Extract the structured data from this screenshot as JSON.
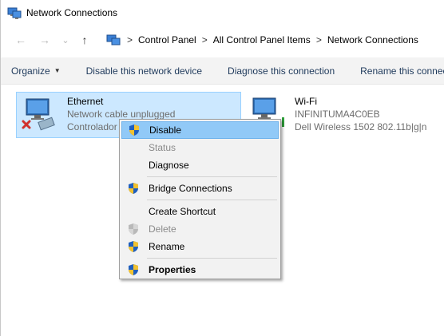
{
  "window": {
    "title": "Network Connections"
  },
  "address": {
    "crumbs": [
      "Control Panel",
      "All Control Panel Items",
      "Network Connections"
    ],
    "separator": ">"
  },
  "nav": {
    "back": "←",
    "forward": "→",
    "recent": "⌄",
    "up": "↑"
  },
  "toolbar": {
    "organize": "Organize",
    "disable": "Disable this network device",
    "diagnose": "Diagnose this connection",
    "rename": "Rename this connection"
  },
  "connections": [
    {
      "name": "Ethernet",
      "status": "Network cable unplugged",
      "adapter": "Controlador Realtek"
    },
    {
      "name": "Wi-Fi",
      "status": "INFINITUMA4C0EB",
      "adapter": "Dell Wireless 1502 802.11b|g|n"
    }
  ],
  "context_menu": {
    "items": [
      {
        "label": "Disable",
        "shield": true,
        "disabled": false,
        "highlighted": true
      },
      {
        "label": "Status",
        "shield": false,
        "disabled": true
      },
      {
        "label": "Diagnose",
        "shield": false,
        "disabled": false
      },
      {
        "label": "Bridge Connections",
        "shield": true,
        "disabled": false
      },
      {
        "label": "Create Shortcut",
        "shield": false,
        "disabled": false
      },
      {
        "label": "Delete",
        "shield": true,
        "disabled": true
      },
      {
        "label": "Rename",
        "shield": true,
        "disabled": false
      },
      {
        "label": "Properties",
        "shield": true,
        "disabled": false,
        "bold": true
      }
    ]
  },
  "colors": {
    "selection_bg": "#cce8ff",
    "menu_highlight": "#91c9f7",
    "command_text": "#1e395b",
    "error_red": "#d0312d"
  }
}
